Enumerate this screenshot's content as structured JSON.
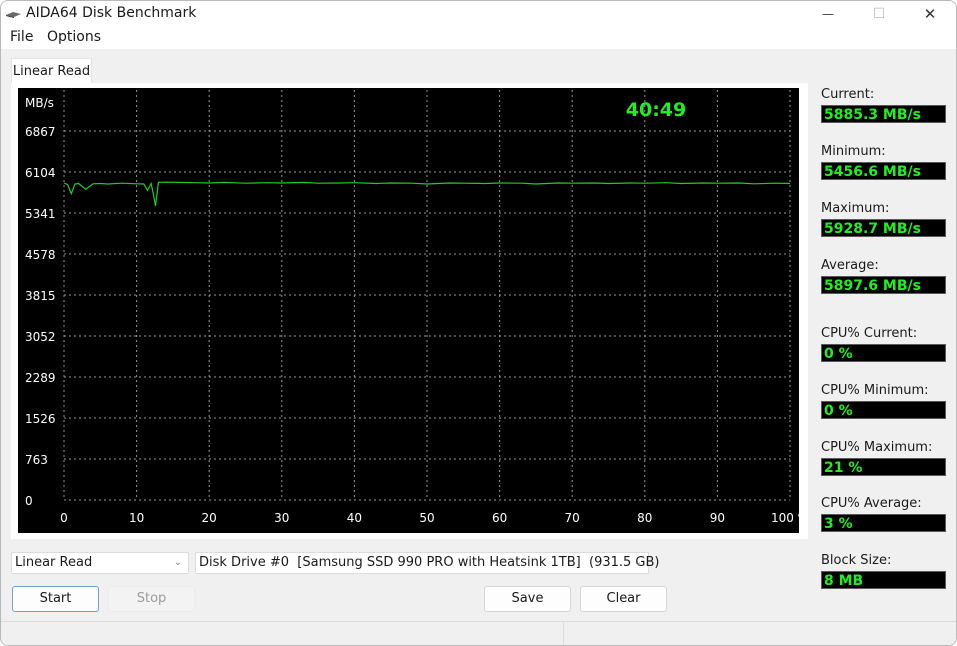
{
  "window": {
    "title": "AIDA64 Disk Benchmark",
    "icon": "disk-icon",
    "controls": {
      "minimize": "—",
      "maximize": "☐",
      "close": "✕"
    }
  },
  "menu": {
    "items": [
      "File",
      "Options"
    ]
  },
  "tab": {
    "label": "Linear Read"
  },
  "chart_data": {
    "type": "line",
    "title": "",
    "elapsed_time": "40:49",
    "ylabel": "MB/s",
    "xlabel": "%",
    "y_ticks": [
      0,
      763,
      1526,
      2289,
      3052,
      3815,
      4578,
      5341,
      6104,
      6867
    ],
    "x_ticks": [
      "0",
      "10",
      "20",
      "30",
      "40",
      "50",
      "60",
      "70",
      "80",
      "90",
      "100 %"
    ],
    "ylim": [
      0,
      7630
    ],
    "xlim": [
      0,
      100
    ],
    "grid": true,
    "series": [
      {
        "name": "Linear Read",
        "color": "#22cc22",
        "x": [
          0,
          0.5,
          1,
          1.5,
          2,
          3,
          4,
          5,
          6,
          8,
          10,
          11,
          11.5,
          12,
          12.3,
          12.6,
          13,
          14,
          16,
          18,
          20,
          22,
          25,
          28,
          30,
          33,
          35,
          38,
          40,
          43,
          45,
          48,
          50,
          53,
          55,
          58,
          60,
          63,
          65,
          68,
          70,
          73,
          75,
          78,
          80,
          83,
          85,
          88,
          90,
          93,
          95,
          98,
          100
        ],
        "values": [
          5900,
          5870,
          5700,
          5880,
          5890,
          5780,
          5885,
          5890,
          5880,
          5895,
          5885,
          5880,
          5760,
          5890,
          5700,
          5470,
          5910,
          5915,
          5910,
          5905,
          5900,
          5910,
          5895,
          5905,
          5900,
          5910,
          5895,
          5900,
          5905,
          5890,
          5900,
          5895,
          5880,
          5900,
          5895,
          5890,
          5900,
          5895,
          5880,
          5900,
          5895,
          5900,
          5890,
          5900,
          5895,
          5905,
          5890,
          5900,
          5895,
          5900,
          5885,
          5895,
          5890
        ]
      }
    ]
  },
  "stats": [
    {
      "label": "Current:",
      "value": "5885.3 MB/s"
    },
    {
      "label": "Minimum:",
      "value": "5456.6 MB/s"
    },
    {
      "label": "Maximum:",
      "value": "5928.7 MB/s"
    },
    {
      "label": "Average:",
      "value": "5897.6 MB/s"
    },
    {
      "label": "CPU% Current:",
      "value": "0 %"
    },
    {
      "label": "CPU% Minimum:",
      "value": "0 %"
    },
    {
      "label": "CPU% Maximum:",
      "value": "21 %"
    },
    {
      "label": "CPU% Average:",
      "value": "3 %"
    },
    {
      "label": "Block Size:",
      "value": "8 MB"
    }
  ],
  "controls": {
    "test_select": "Linear Read",
    "drive_select": "Disk Drive #0  [Samsung SSD 990 PRO with Heatsink 1TB]  (931.5 GB)",
    "start": "Start",
    "stop": "Stop",
    "save": "Save",
    "clear": "Clear",
    "chevron": "⌄"
  }
}
